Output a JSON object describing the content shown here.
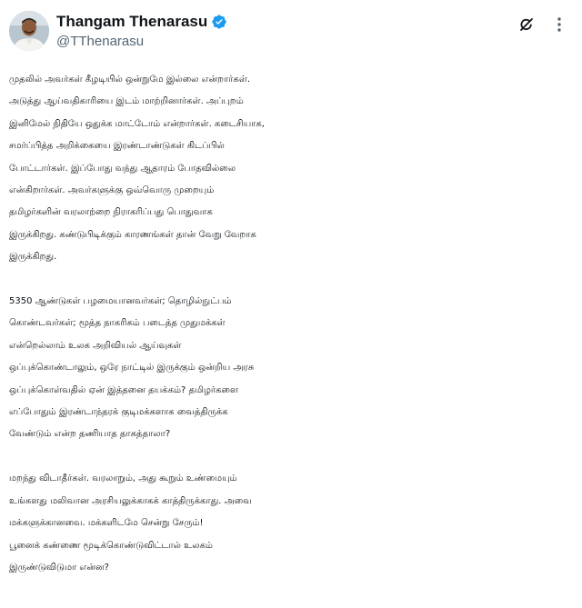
{
  "author": {
    "display_name": "Thangam Thenarasu",
    "handle": "@TThenarasu",
    "verified": true,
    "verified_color": "#1d9bf0",
    "avatar_icon": "profile-photo"
  },
  "actions": {
    "grok_icon": "grok-icon",
    "more_icon": "more-options-icon"
  },
  "post": {
    "paragraphs": [
      {
        "lines": [
          "முதலில் அவர்கள் கீழடியில் ஒன்றுமே இல்லை என்றார்கள்.",
          "அடுத்து ஆய்வதிகாரியை இடம் மாற்றினார்கள். அப்புறம்",
          "இனிமேல் நிதியே ஒதுக்க மாட்டோம் என்றார்கள். கடைசியாக,",
          "சமர்ப்பித்த அறிக்கையை இரண்டாண்டுகள் கிடப்பில்",
          "போட்டார்கள். இப்போது வந்து ஆதாரம் போதவில்லை",
          "என்கிறார்கள். அவர்களுக்கு ஒவ்வொரு முறையும்",
          "தமிழர்களின் வரலாற்றை நிராகரிப்பது பொதுவாக",
          "இருக்கிறது. கண்டுபிடிக்கும் காரணங்கள் தான் வேறு வேறாக",
          "இருக்கிறது."
        ]
      },
      {
        "lines": [
          "5350 ஆண்டுகள் பழமையானவர்கள்; தொழில்நுட்பம்",
          "கொண்டவர்கள்; மூத்த நாகரிகம் படைத்த முதுமக்கள்",
          "என்றெல்லாம் உலக அறிவியல் ஆய்வுகள்",
          "ஒப்புக்கொண்டாலும், ஒரே நாட்டில் இருக்கும் ஒன்றிய அரசு",
          "ஒப்புக்கொள்வதில்  ஏன் இத்தனை தயக்கம்? தமிழர்களை",
          "எப்போதும் இரண்டாந்தரக் குடிமக்களாக வைத்திருக்க",
          "வேண்டும் என்ற தணியாத தாகத்தாலா?"
        ]
      },
      {
        "lines": [
          "மறந்து விடாதீர்கள். வரலாறும், அது கூறும் உண்மையும்",
          "உங்களது மலிவான அரசியலுக்காகக் காத்திருக்காது. அவை",
          "மக்களுக்கானவை. மக்களிடமே சென்று சேரும்!",
          "பூனைக் கண்ணை மூடிக்கொண்டுவிட்டால் உலகம்",
          "இருண்டுவிடுமா என்ன?"
        ]
      }
    ]
  }
}
